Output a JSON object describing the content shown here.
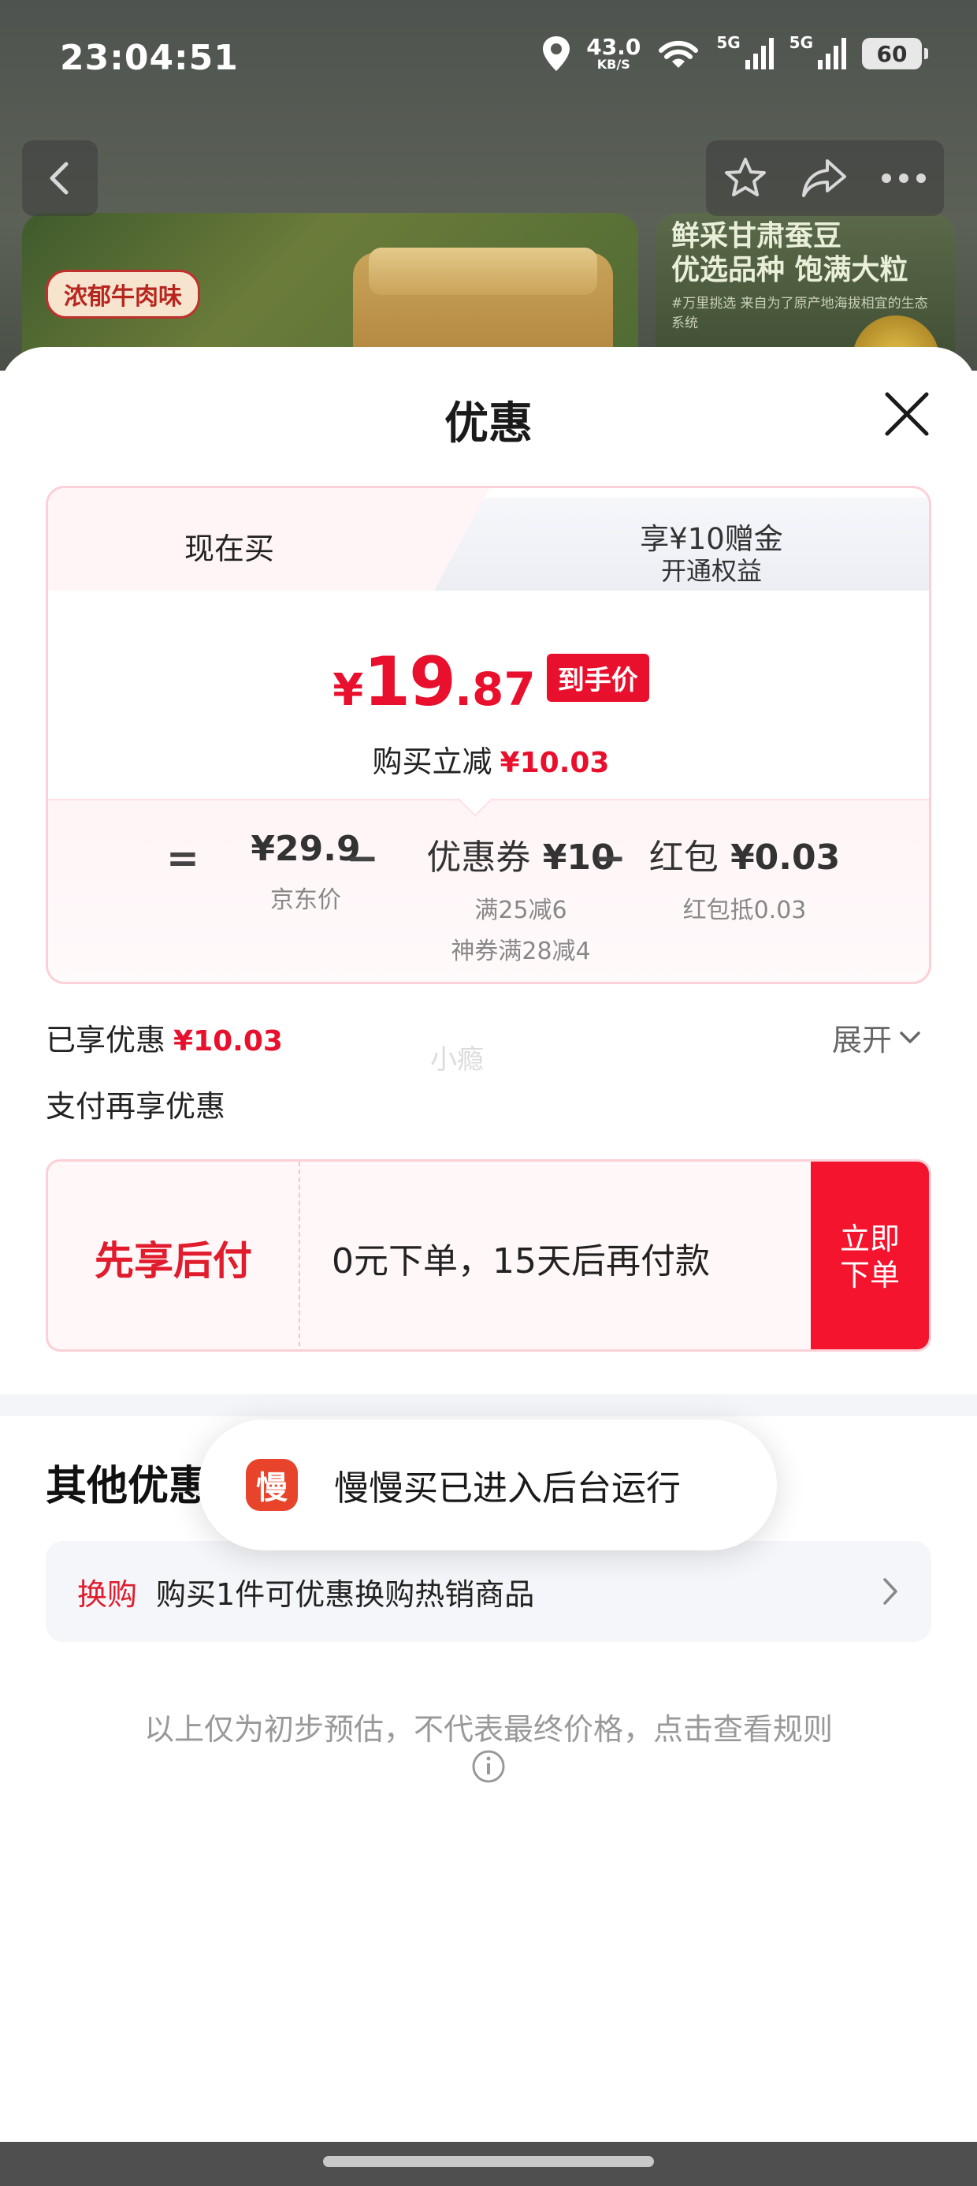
{
  "status_bar": {
    "time": "23:04:51",
    "net_speed_value": "43.0",
    "net_speed_unit": "KB/S",
    "signal_1_label": "5G",
    "signal_2_label": "5G",
    "battery": "60",
    "icons": [
      "location-icon",
      "wifi-icon",
      "signal-icon",
      "signal-icon",
      "battery-icon"
    ]
  },
  "product_page": {
    "image_1_tag": "浓郁牛肉味",
    "image_2_title_1": "鲜采甘肃蚕豆",
    "image_2_title_2": "优选品种 饱满大粒",
    "image_2_subtitle": "#万里挑选 来自为了原产地海拔相宜的生态系统",
    "nav_icons": [
      "back-icon",
      "star-icon",
      "share-icon",
      "more-icon"
    ]
  },
  "sheet": {
    "title": "优惠",
    "tabs": {
      "active": "现在买",
      "other_line1": "享¥10赠金",
      "other_line2": "开通权益"
    },
    "price": {
      "symbol": "¥",
      "integer": "19",
      "decimal": ".87",
      "badge": "到手价",
      "reduce_label": "购买立减",
      "reduce_amount": "¥10.03"
    },
    "calc": {
      "equals": "=",
      "minus": "−",
      "jd_price": "¥29.9",
      "jd_price_label": "京东价",
      "coupon_label": "优惠券",
      "coupon_value": "¥10",
      "coupon_sub1": "满25减6",
      "coupon_sub2": "神券满28减4",
      "redpacket_label": "红包",
      "redpacket_value": "¥0.03",
      "redpacket_sub": "红包抵0.03"
    },
    "enjoyed_label": "已享优惠",
    "enjoyed_amount": "¥10.03",
    "watermark": "小瘾",
    "expand_label": "展开",
    "pay_more_label": "支付再享优惠",
    "pay_later": {
      "title": "先享后付",
      "desc": "0元下单，15天后再付款",
      "btn_line1": "立即",
      "btn_line2": "下单"
    },
    "other_title": "其他优惠",
    "swap": {
      "tag": "换购",
      "text": "购买1件可优惠换购热销商品"
    },
    "disclaimer": "以上仅为初步预估，不代表最终价格，点击查看规则"
  },
  "toast": {
    "icon_char": "慢",
    "text": "慢慢买已进入后台运行"
  },
  "colors": {
    "accent_red": "#e8102c",
    "card_border": "#fbd0d6",
    "pay_button": "#f4142e"
  }
}
